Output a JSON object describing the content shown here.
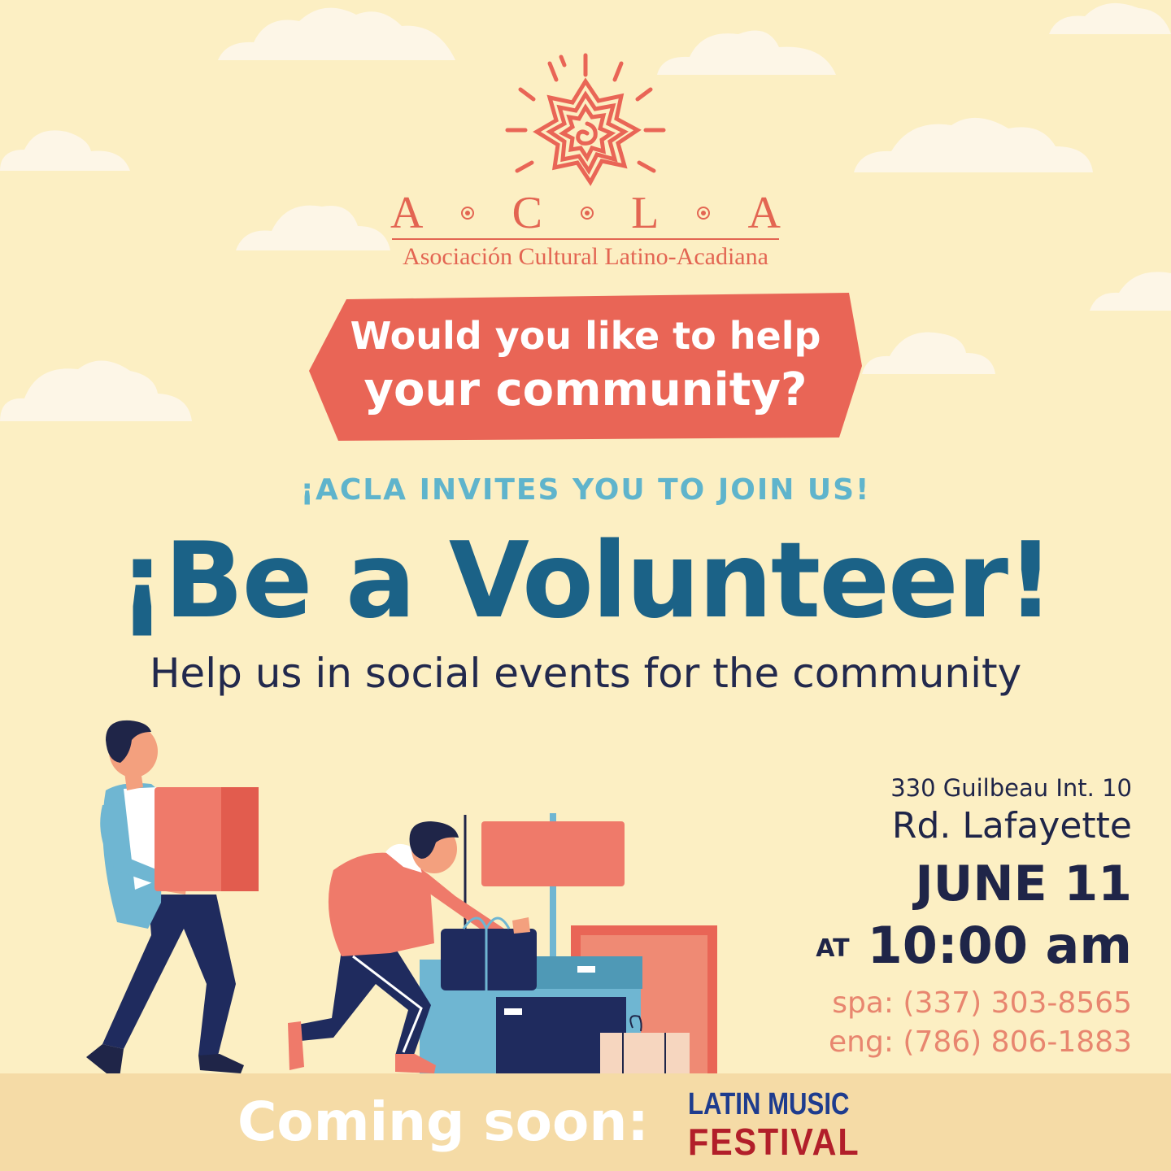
{
  "logo": {
    "letters": [
      "A",
      "C",
      "L",
      "A"
    ],
    "name": "Asociación Cultural Latino-Acadiana"
  },
  "banner": {
    "line1": "Would you like to help",
    "line2": "your community?"
  },
  "invite": "¡ACLA INVITES YOU TO JOIN US!",
  "headline": "¡Be a Volunteer!",
  "subline": "Help us in social events for the community",
  "event": {
    "address_line1": "330 Guilbeau Int. 10",
    "address_line2": "Rd. Lafayette",
    "date": "JUNE 11",
    "at": "AT",
    "time": "10:00 am",
    "phone_spa": "spa: (337) 303-8565",
    "phone_eng": "eng: (786) 806-1883"
  },
  "footer": {
    "coming_soon": "Coming soon:",
    "festival_line1": "LATIN MUSIC",
    "festival_line2": "FESTIVAL"
  },
  "colors": {
    "background": "#fcefc3",
    "accent_coral": "#e96556",
    "headline_blue": "#1b6287",
    "invite_blue": "#5fb4cc",
    "navy": "#1f2548"
  }
}
